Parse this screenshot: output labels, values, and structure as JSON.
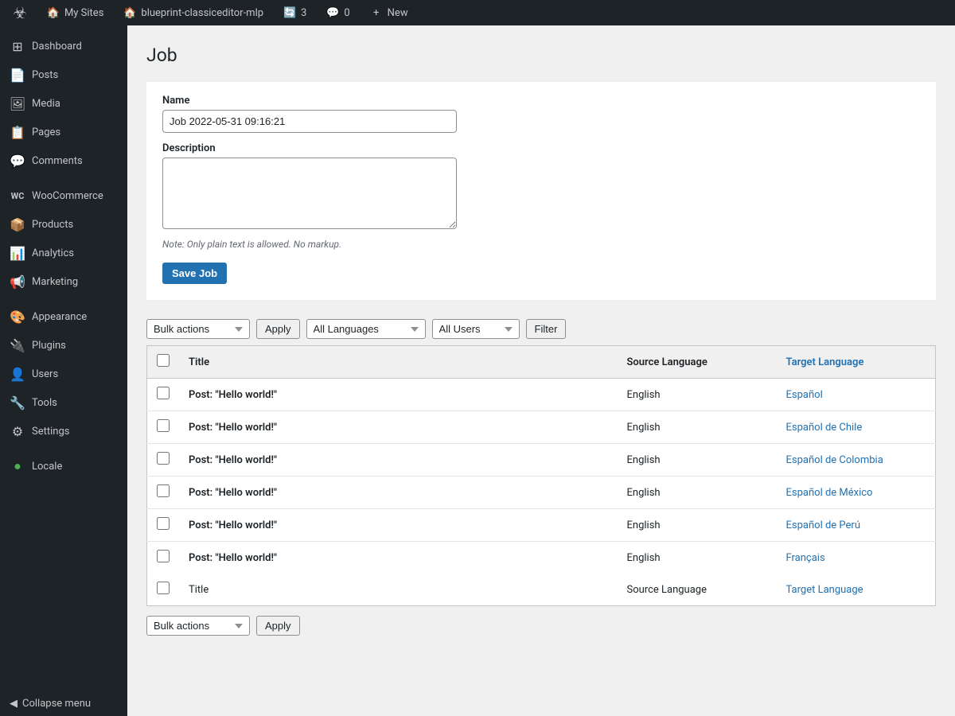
{
  "adminBar": {
    "wpLogoSymbol": "W",
    "items": [
      {
        "id": "my-sites",
        "icon": "🏠",
        "label": "My Sites"
      },
      {
        "id": "site-name",
        "icon": "🏠",
        "label": "blueprint-classiceditor-mlp"
      },
      {
        "id": "updates",
        "icon": "🔄",
        "label": "3"
      },
      {
        "id": "comments",
        "icon": "💬",
        "label": "0"
      },
      {
        "id": "new",
        "icon": "+",
        "label": "New"
      }
    ]
  },
  "sidebar": {
    "items": [
      {
        "id": "dashboard",
        "icon": "⊞",
        "label": "Dashboard"
      },
      {
        "id": "posts",
        "icon": "📄",
        "label": "Posts"
      },
      {
        "id": "media",
        "icon": "🖼",
        "label": "Media"
      },
      {
        "id": "pages",
        "icon": "📋",
        "label": "Pages"
      },
      {
        "id": "comments",
        "icon": "💬",
        "label": "Comments"
      },
      {
        "id": "woocommerce",
        "icon": "W",
        "label": "WooCommerce"
      },
      {
        "id": "products",
        "icon": "📦",
        "label": "Products"
      },
      {
        "id": "analytics",
        "icon": "📊",
        "label": "Analytics"
      },
      {
        "id": "marketing",
        "icon": "📢",
        "label": "Marketing"
      },
      {
        "id": "appearance",
        "icon": "🎨",
        "label": "Appearance"
      },
      {
        "id": "plugins",
        "icon": "🔌",
        "label": "Plugins"
      },
      {
        "id": "users",
        "icon": "👤",
        "label": "Users"
      },
      {
        "id": "tools",
        "icon": "🔧",
        "label": "Tools"
      },
      {
        "id": "settings",
        "icon": "⚙",
        "label": "Settings"
      },
      {
        "id": "locale",
        "icon": "🌐",
        "label": "Locale"
      }
    ],
    "collapseLabel": "Collapse menu"
  },
  "page": {
    "title": "Job",
    "form": {
      "nameLabel": "Name",
      "nameValue": "Job 2022-05-31 09:16:21",
      "descriptionLabel": "Description",
      "descriptionValue": "",
      "descriptionPlaceholder": "",
      "noteText": "Note: Only plain text is allowed. No markup.",
      "saveButtonLabel": "Save Job"
    },
    "topControls": {
      "bulkActionsLabel": "Bulk actions",
      "allLanguagesLabel": "All Languages",
      "allUsersLabel": "All Users",
      "applyLabel": "Apply",
      "filterLabel": "Filter"
    },
    "table": {
      "columns": {
        "title": "Title",
        "sourceLanguage": "Source Language",
        "targetLanguage": "Target Language"
      },
      "rows": [
        {
          "id": 1,
          "title": "Post: \"Hello world!\"",
          "source": "English",
          "target": "Español"
        },
        {
          "id": 2,
          "title": "Post: \"Hello world!\"",
          "source": "English",
          "target": "Español de Chile"
        },
        {
          "id": 3,
          "title": "Post: \"Hello world!\"",
          "source": "English",
          "target": "Español de Colombia"
        },
        {
          "id": 4,
          "title": "Post: \"Hello world!\"",
          "source": "English",
          "target": "Español de México"
        },
        {
          "id": 5,
          "title": "Post: \"Hello world!\"",
          "source": "English",
          "target": "Español de Perú"
        },
        {
          "id": 6,
          "title": "Post: \"Hello world!\"",
          "source": "English",
          "target": "Français"
        }
      ],
      "footerColumns": {
        "title": "Title",
        "sourceLanguage": "Source Language",
        "targetLanguage": "Target Language"
      }
    },
    "bottomControls": {
      "bulkActionsLabel": "Bulk actions",
      "applyLabel": "Apply"
    }
  }
}
